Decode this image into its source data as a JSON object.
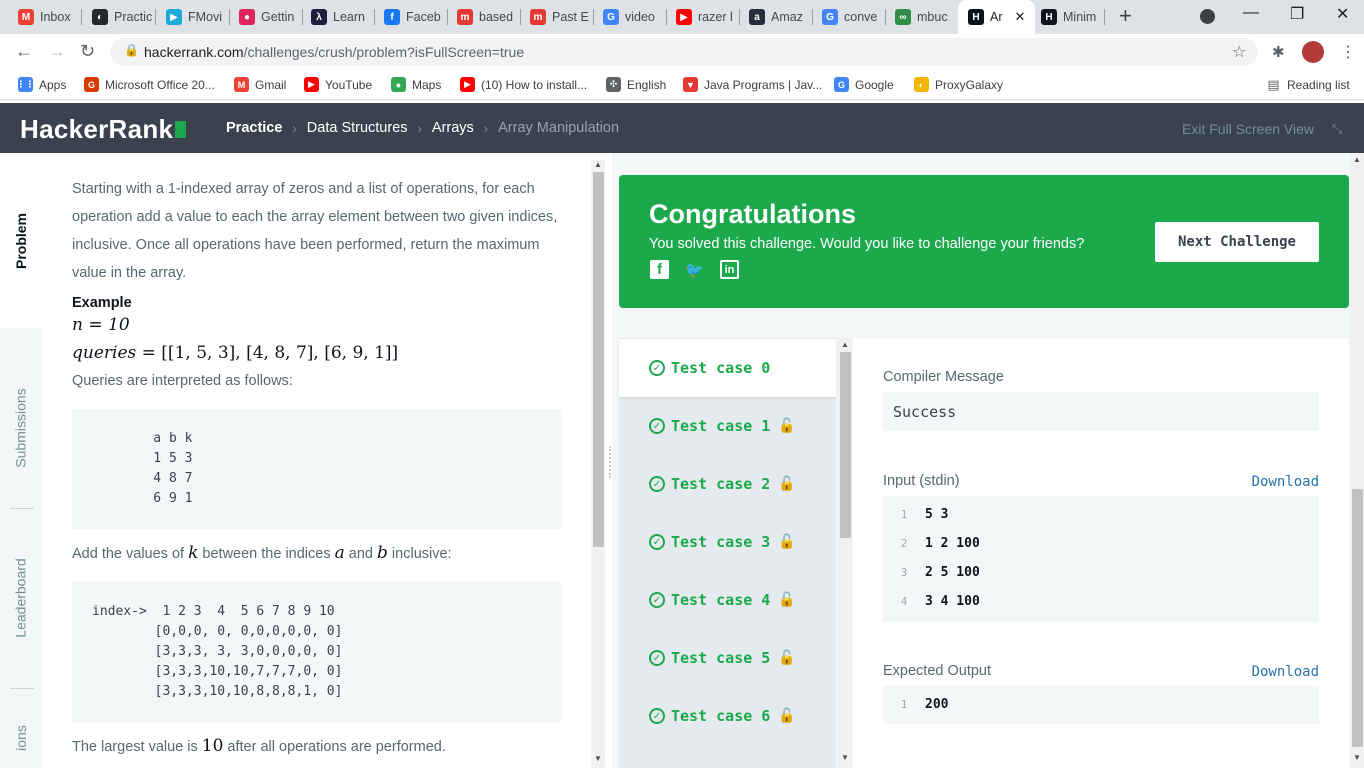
{
  "browser": {
    "tabs": [
      {
        "label": "Inbox",
        "icon": "gmail-icon",
        "color": "#ea4335",
        "glyph": "M"
      },
      {
        "label": "Practic",
        "icon": "github-icon",
        "color": "#24292e",
        "glyph": "◐"
      },
      {
        "label": "FMovi",
        "icon": "play-icon",
        "color": "#1aa9d8",
        "glyph": "▶"
      },
      {
        "label": "Gettin",
        "icon": "record-icon",
        "color": "#e0245e",
        "glyph": "●"
      },
      {
        "label": "Learn",
        "icon": "learn-icon",
        "color": "#1b1f3b",
        "glyph": "λ"
      },
      {
        "label": "Faceb",
        "icon": "facebook-icon",
        "color": "#1877f2",
        "glyph": "f"
      },
      {
        "label": "based",
        "icon": "m-logo-icon",
        "color": "#e53935",
        "glyph": "m"
      },
      {
        "label": "Past E",
        "icon": "m-logo-icon",
        "color": "#e53935",
        "glyph": "m"
      },
      {
        "label": "video",
        "icon": "google-icon",
        "color": "#4285f4",
        "glyph": "G"
      },
      {
        "label": "razer l",
        "icon": "youtube-icon",
        "color": "#ff0000",
        "glyph": "▶"
      },
      {
        "label": "Amaz",
        "icon": "amazon-icon",
        "color": "#232f3e",
        "glyph": "a"
      },
      {
        "label": "conve",
        "icon": "google-icon",
        "color": "#4285f4",
        "glyph": "G"
      },
      {
        "label": "mbuc",
        "icon": "gfg-icon",
        "color": "#2f8d46",
        "glyph": "∞"
      },
      {
        "label": "Ar",
        "icon": "hackerrank-icon",
        "color": "#0e141e",
        "glyph": "H"
      },
      {
        "label": "Minim",
        "icon": "hackerrank-icon",
        "color": "#0e141e",
        "glyph": "H"
      }
    ],
    "url_main": "hackerrank.com",
    "url_rest": "/challenges/crush/problem?isFullScreen=true",
    "bookmarks": [
      {
        "label": "Apps",
        "icon": "apps-grid-icon",
        "color": "#4285f4",
        "glyph": "⋮⋮"
      },
      {
        "label": "Microsoft Office 20...",
        "icon": "office-icon",
        "color": "#d83b01",
        "glyph": "G"
      },
      {
        "label": "Gmail",
        "icon": "gmail-icon",
        "color": "#ea4335",
        "glyph": "M"
      },
      {
        "label": "YouTube",
        "icon": "youtube-icon",
        "color": "#ff0000",
        "glyph": "▶"
      },
      {
        "label": "Maps",
        "icon": "maps-pin-icon",
        "color": "#34a853",
        "glyph": "●"
      },
      {
        "label": "(10) How to install...",
        "icon": "youtube-icon",
        "color": "#ff0000",
        "glyph": "▶"
      },
      {
        "label": "English",
        "icon": "translate-icon",
        "color": "#5f6368",
        "glyph": "✣"
      },
      {
        "label": "Java Programs | Jav...",
        "icon": "java-icon",
        "color": "#e53935",
        "glyph": "▼"
      },
      {
        "label": "Google",
        "icon": "google-icon",
        "color": "#4285f4",
        "glyph": "G"
      },
      {
        "label": "ProxyGalaxy",
        "icon": "proxy-icon",
        "color": "#f4b400",
        "glyph": "◐"
      }
    ],
    "reading_list": "Reading list"
  },
  "header": {
    "logo": "HackerRank",
    "crumbs": [
      "Practice",
      "Data Structures",
      "Arrays",
      "Array Manipulation"
    ],
    "exit": "Exit Full Screen View"
  },
  "side_tabs": [
    "Problem",
    "Submissions",
    "Leaderboard",
    "ions"
  ],
  "problem": {
    "intro": "Starting with a 1-indexed array of zeros and a list of operations, for each operation add a value to each the array element between two given indices, inclusive. Once all operations have been performed, return the maximum value in the array.",
    "example_heading": "Example",
    "n_eq": "n = 10",
    "queries_var": "queries",
    "queries_eq": " = [[1, 5, 3], [4, 8, 7], [6, 9, 1]]",
    "interp": "Queries are interpreted as follows:",
    "code1": "    a b k\n    1 5 3\n    4 8 7\n    6 9 1",
    "add_pre": "Add the values of ",
    "add_k": "k",
    "add_mid": " between the indices ",
    "add_a": "a",
    "add_and": " and ",
    "add_b": "b",
    "add_post": " inclusive:",
    "code2": "index->  1 2 3  4  5 6 7 8 9 10\n        [0,0,0, 0, 0,0,0,0,0, 0]\n        [3,3,3, 3, 3,0,0,0,0, 0]\n        [3,3,3,10,10,7,7,7,0, 0]\n        [3,3,3,10,10,8,8,8,1, 0]",
    "largest_pre": "The largest value is ",
    "largest_val": "10",
    "largest_post": " after all operations are performed."
  },
  "congrats": {
    "title": "Congratulations",
    "subtitle": "You solved this challenge. Would you like to challenge your friends?",
    "next_button": "Next Challenge",
    "social": [
      {
        "icon": "facebook-icon",
        "glyph": "f"
      },
      {
        "icon": "twitter-icon",
        "glyph": "🐦"
      },
      {
        "icon": "linkedin-icon",
        "glyph": "in"
      }
    ]
  },
  "test_cases": [
    {
      "label": "Test case 0",
      "locked": false
    },
    {
      "label": "Test case 1",
      "locked": true
    },
    {
      "label": "Test case 2",
      "locked": true
    },
    {
      "label": "Test case 3",
      "locked": true
    },
    {
      "label": "Test case 4",
      "locked": true
    },
    {
      "label": "Test case 5",
      "locked": true
    },
    {
      "label": "Test case 6",
      "locked": true
    }
  ],
  "output": {
    "compiler_label": "Compiler Message",
    "compiler_msg": "Success",
    "input_label": "Input (stdin)",
    "download": "Download",
    "input_lines": [
      "5 3",
      "1 2 100",
      "2 5 100",
      "3 4 100"
    ],
    "expected_label": "Expected Output",
    "expected_lines": [
      "200"
    ]
  },
  "colors": {
    "accent": "#1ba94c",
    "header": "#39424e",
    "link": "#2574a9"
  }
}
